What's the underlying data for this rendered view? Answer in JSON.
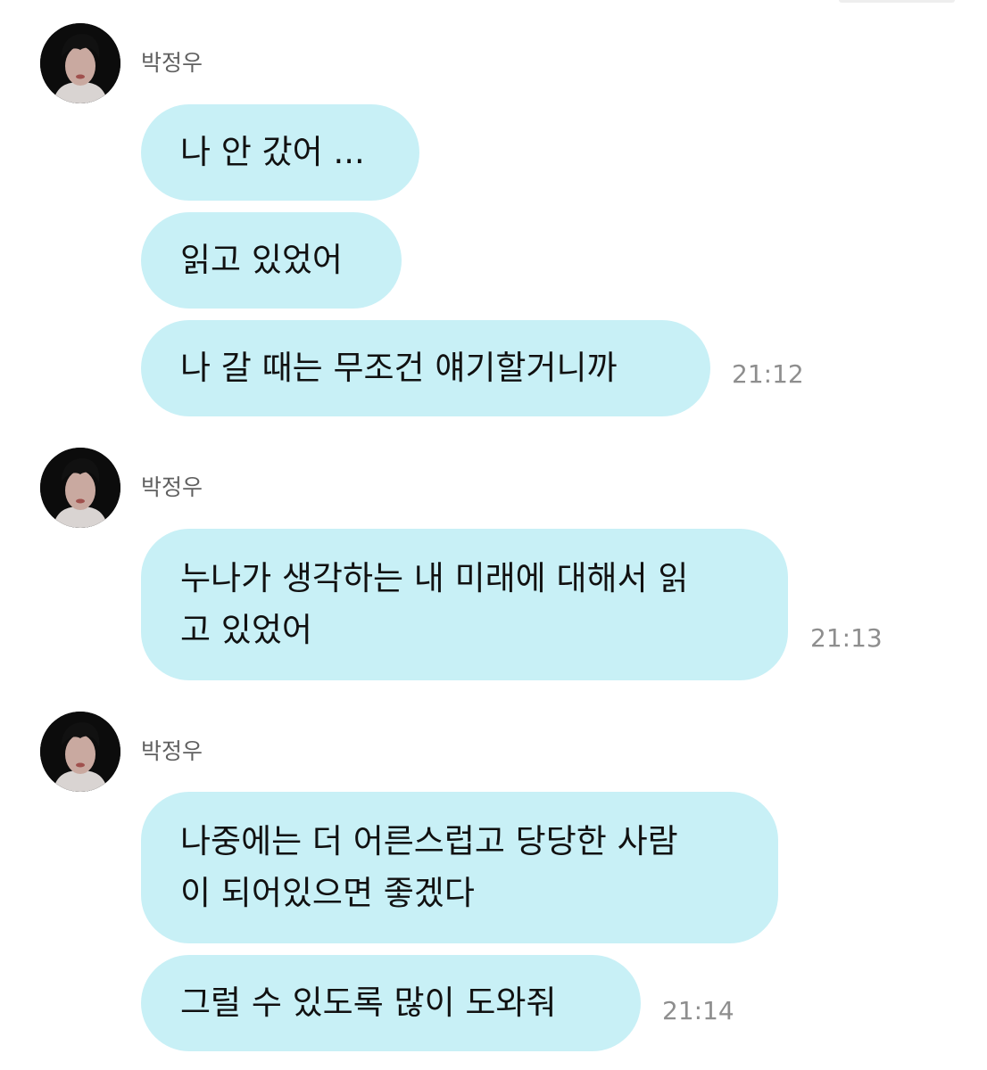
{
  "messages": [
    {
      "sender": "박정우",
      "bubbles": [
        {
          "lines": [
            "나 안 갔어 ..."
          ]
        },
        {
          "lines": [
            "읽고 있었어"
          ]
        },
        {
          "lines": [
            "나 갈 때는 무조건 얘기할거니까"
          ],
          "time": "21:12"
        }
      ]
    },
    {
      "sender": "박정우",
      "bubbles": [
        {
          "lines": [
            "누나가 생각하는 내 미래에 대해서 읽",
            "고 있었어"
          ],
          "time": "21:13"
        }
      ]
    },
    {
      "sender": "박정우",
      "bubbles": [
        {
          "lines": [
            "나중에는 더 어른스럽고 당당한 사람",
            "이 되어있으면 좋겠다"
          ]
        },
        {
          "lines": [
            "그럴 수 있도록 많이 도와줘"
          ],
          "time": "21:14"
        }
      ]
    }
  ]
}
